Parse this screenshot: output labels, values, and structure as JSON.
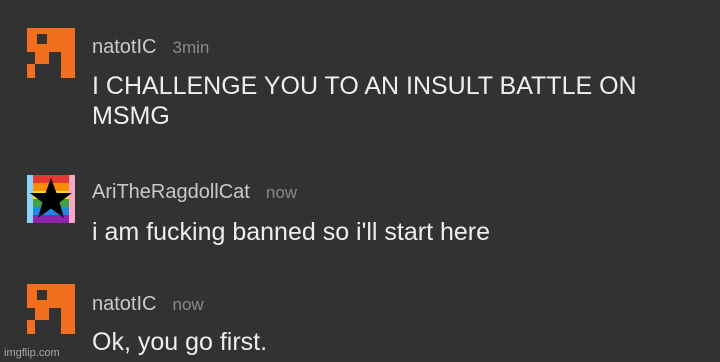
{
  "messages": [
    {
      "user": "natotIC",
      "time": "3min",
      "text": "I CHALLENGE YOU TO AN INSULT BATTLE ON MSMG",
      "avatar": "orange-blocky-icon"
    },
    {
      "user": "AriTheRagdollCat",
      "time": "now",
      "text": "i am fucking banned so i'll start here",
      "avatar": "rainbow-star-icon"
    },
    {
      "user": "natotIC",
      "time": "now",
      "text": "Ok, you go first.",
      "avatar": "orange-blocky-icon"
    }
  ],
  "watermark": "imgflip.com",
  "colors": {
    "background": "#323232",
    "accent_orange": "#f2701d"
  }
}
